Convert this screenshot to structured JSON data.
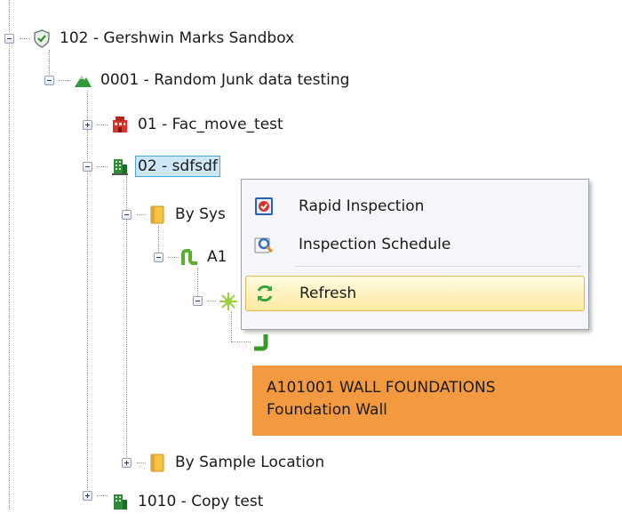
{
  "tree": {
    "project": "102 - Gershwin Marks Sandbox",
    "site": "0001 - Random Junk data testing",
    "fac_move": "01 - Fac_move_test",
    "building": "02 - sdfsdf",
    "by_system": "By Sys",
    "system_item": "A1",
    "by_sample": "By Sample Location",
    "copy_test": "1010 - Copy test"
  },
  "context_menu": {
    "items": [
      {
        "label": "Rapid Inspection",
        "icon": "rapid-inspection-icon"
      },
      {
        "label": "Inspection Schedule",
        "icon": "inspection-schedule-icon"
      },
      {
        "label": "Refresh",
        "icon": "refresh-icon"
      }
    ]
  },
  "tooltip": {
    "line1": "A101001 WALL FOUNDATIONS",
    "line2": "Foundation Wall"
  },
  "colors": {
    "selection": "#cde7f7",
    "tooltip": "#f39a41",
    "menu_hot": "#fde9a2"
  }
}
